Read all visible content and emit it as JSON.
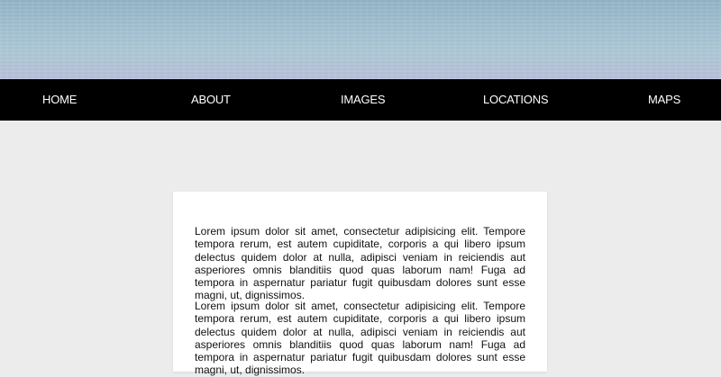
{
  "nav": {
    "items": [
      {
        "label": "HOME"
      },
      {
        "label": "ABOUT"
      },
      {
        "label": "IMAGES"
      },
      {
        "label": "LOCATIONS"
      },
      {
        "label": "MAPS"
      }
    ]
  },
  "content": {
    "paragraphs": [
      "Lorem ipsum dolor sit amet, consectetur adipisicing elit. Tempore tempora rerum, est autem cupiditate, corporis a qui libero ipsum delectus quidem dolor at nulla, adipisci veniam in reiciendis aut asperiores omnis blanditiis quod quas laborum nam! Fuga ad tempora in aspernatur pariatur fugit quibusdam dolores sunt esse magni, ut, dignissimos.",
      "Lorem ipsum dolor sit amet, consectetur adipisicing elit. Tempore tempora rerum, est autem cupiditate, corporis a qui libero ipsum delectus quidem dolor at nulla, adipisci veniam in reiciendis aut asperiores omnis blanditiis quod quas laborum nam! Fuga ad tempora in aspernatur pariatur fugit quibusdam dolores sunt esse magni, ut, dignissimos."
    ]
  }
}
